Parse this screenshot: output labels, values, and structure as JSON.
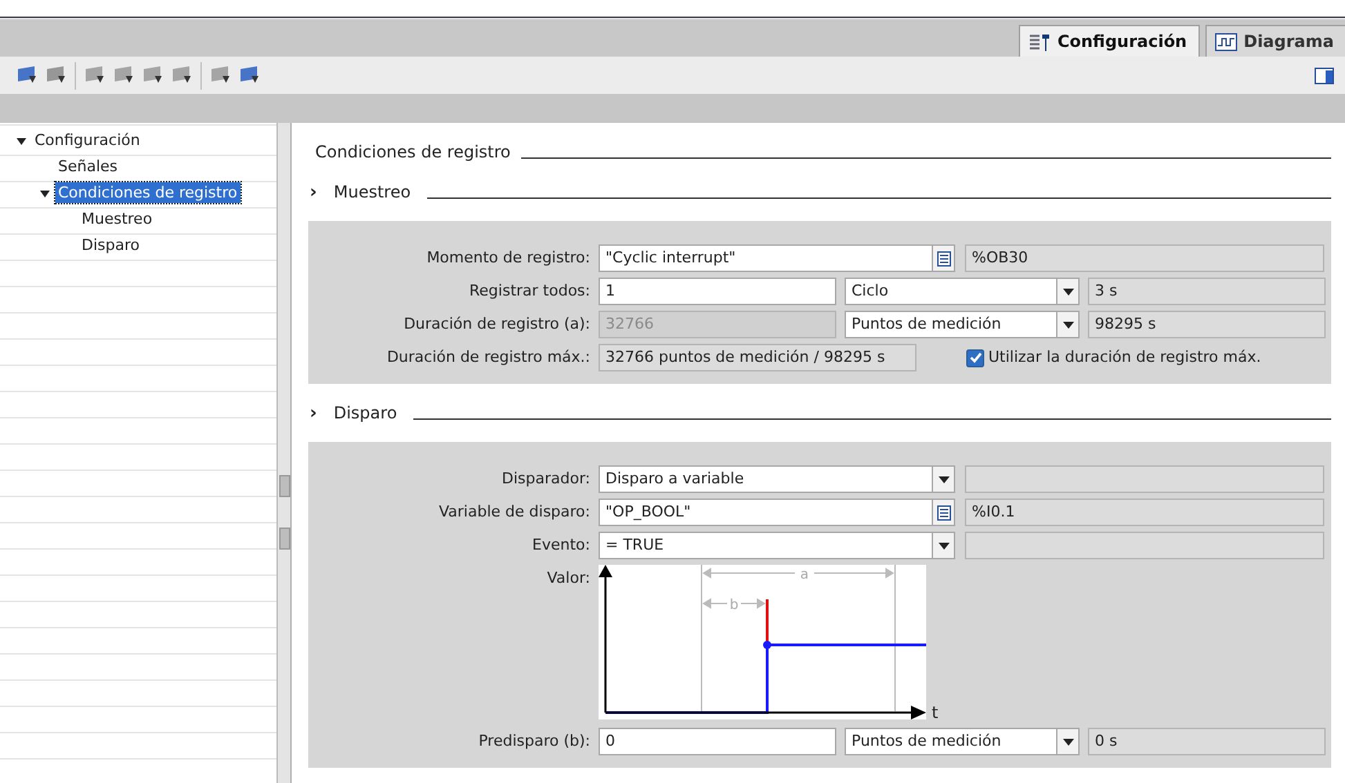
{
  "tabs": [
    {
      "label": "Configuración",
      "selected": true
    },
    {
      "label": "Diagrama",
      "selected": false
    }
  ],
  "tree": [
    {
      "label": "Configuración",
      "expanded": true,
      "selected": false,
      "children": [
        {
          "label": "Señales",
          "selected": false
        },
        {
          "label": "Condiciones de registro",
          "expanded": true,
          "selected": true,
          "children": [
            {
              "label": "Muestreo",
              "selected": false
            },
            {
              "label": "Disparo",
              "selected": false
            }
          ]
        }
      ]
    }
  ],
  "title": "Condiciones de registro",
  "sections": [
    {
      "expander": "›",
      "title": "Muestreo",
      "rows": [
        {
          "label": "Momento de registro:",
          "controls": [
            {
              "kind": "browse",
              "value": "\"Cyclic interrupt\"",
              "wide": true
            },
            {
              "kind": "readonly",
              "value": "%OB30",
              "wide": true
            }
          ]
        },
        {
          "label": "Registrar todos:",
          "controls": [
            {
              "kind": "input",
              "value": "1",
              "wide": false
            },
            {
              "kind": "select",
              "value": "Ciclo",
              "wide": false
            },
            {
              "kind": "readonly",
              "value": "3 s",
              "wide": false
            }
          ]
        },
        {
          "label": "Duración de registro (a):",
          "controls": [
            {
              "kind": "disabled",
              "value": "32766",
              "wide": false
            },
            {
              "kind": "select",
              "value": "Puntos de medición",
              "wide": false
            },
            {
              "kind": "readonly",
              "value": "98295 s",
              "wide": false
            }
          ]
        },
        {
          "label": "Duración de registro máx.:",
          "controls": [
            {
              "kind": "info",
              "value": "32766 puntos de medición / 98295 s",
              "wide": false
            },
            {
              "kind": "checkbox",
              "label": "Utilizar la duración de registro máx.",
              "checked": true
            }
          ]
        }
      ]
    },
    {
      "expander": "›",
      "title": "Disparo",
      "rows": [
        {
          "label": "Disparador:",
          "controls": [
            {
              "kind": "select",
              "value": "Disparo a variable",
              "wide": true
            },
            {
              "kind": "readonly",
              "wide": true
            }
          ]
        },
        {
          "label": "Variable de disparo:",
          "controls": [
            {
              "kind": "browse",
              "value": "\"OP_BOOL\"",
              "wide": true
            },
            {
              "kind": "readonly",
              "value": "%I0.1",
              "wide": true
            }
          ]
        },
        {
          "label": "Evento:",
          "controls": [
            {
              "kind": "select",
              "value": "= TRUE",
              "wide": true
            },
            {
              "kind": "readonly",
              "wide": true
            }
          ]
        },
        {
          "label": "Valor:",
          "controls": [
            {
              "kind": "diagram",
              "interval_long": "a",
              "interval_short": "b",
              "time_axis": "t"
            }
          ]
        },
        {
          "label": "Predisparo (b):",
          "controls": [
            {
              "kind": "input",
              "value": "0",
              "wide": false
            },
            {
              "kind": "select",
              "value": "Puntos de medición",
              "wide": false
            },
            {
              "kind": "readonly",
              "value": "0 s",
              "wide": false
            }
          ]
        }
      ]
    }
  ]
}
